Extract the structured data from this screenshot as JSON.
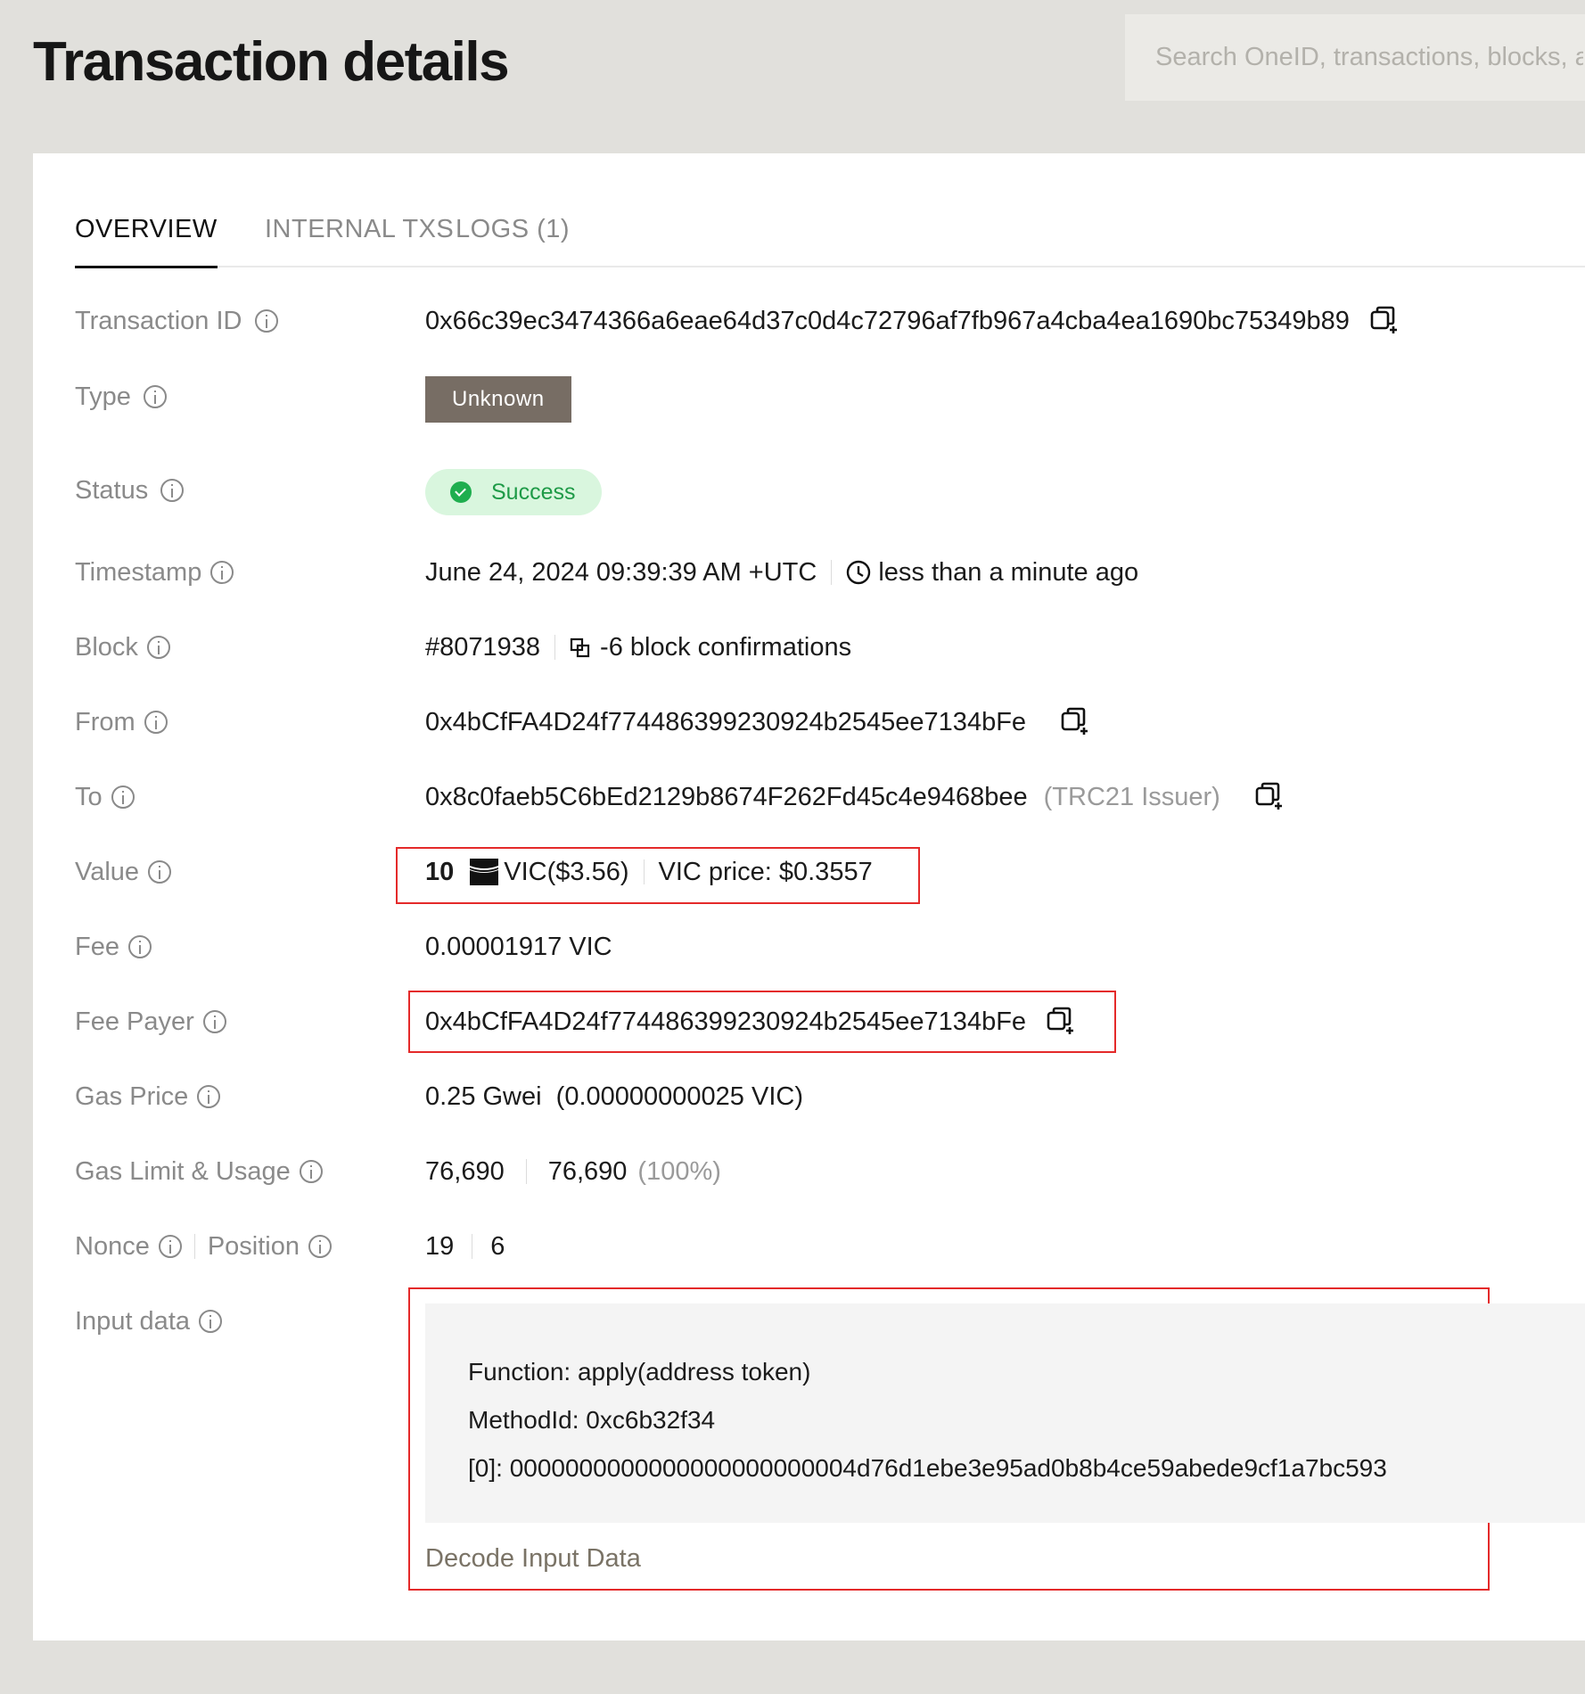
{
  "header": {
    "title": "Transaction details",
    "search_placeholder": "Search OneID, transactions, blocks, a"
  },
  "tabs": [
    {
      "label": "OVERVIEW",
      "active": true
    },
    {
      "label": "INTERNAL TXS",
      "active": false
    },
    {
      "label": "LOGS (1)",
      "active": false
    }
  ],
  "rows": {
    "transaction_id": {
      "label": "Transaction ID",
      "value": "0x66c39ec3474366a6eae64d37c0d4c72796af7fb967a4cba4ea1690bc75349b89"
    },
    "type": {
      "label": "Type",
      "value": "Unknown"
    },
    "status": {
      "label": "Status",
      "value": "Success"
    },
    "timestamp": {
      "label": "Timestamp",
      "value": "June 24, 2024 09:39:39 AM +UTC",
      "relative": "less than a minute ago"
    },
    "block": {
      "label": "Block",
      "value": "#8071938",
      "confirmations": "-6 block confirmations"
    },
    "from": {
      "label": "From",
      "value": "0x4bCfFA4D24f774486399230924b2545ee7134bFe"
    },
    "to": {
      "label": "To",
      "value": "0x8c0faeb5C6bEd2129b8674F262Fd45c4e9468bee",
      "tag": "(TRC21 Issuer)"
    },
    "value": {
      "label": "Value",
      "amount": "10",
      "unit": "VIC($3.56)",
      "price": "VIC price: $0.3557"
    },
    "fee": {
      "label": "Fee",
      "value": "0.00001917 VIC"
    },
    "fee_payer": {
      "label": "Fee Payer",
      "value": "0x4bCfFA4D24f774486399230924b2545ee7134bFe"
    },
    "gas_price": {
      "label": "Gas Price",
      "value": "0.25 Gwei  (0.00000000025 VIC)"
    },
    "gas_limit": {
      "label": "Gas Limit & Usage",
      "limit": "76,690",
      "usage": "76,690",
      "percent": "(100%)"
    },
    "nonce": {
      "label": "Nonce",
      "label2": "Position",
      "nonce": "19",
      "position": "6"
    },
    "input_data": {
      "label": "Input data",
      "lines": [
        "Function: apply(address token)",
        "MethodId: 0xc6b32f34",
        "[0]: 0000000000000000000000004d76d1ebe3e95ad0b8b4ce59abede9cf1a7bc593"
      ],
      "decode_link": "Decode Input Data"
    }
  },
  "colors": {
    "background": "#e1e0dc",
    "success_bg": "#d9f6de",
    "success_text": "#1e9a47",
    "unknown_badge": "#776d64",
    "highlight_border": "#e42a2a"
  }
}
